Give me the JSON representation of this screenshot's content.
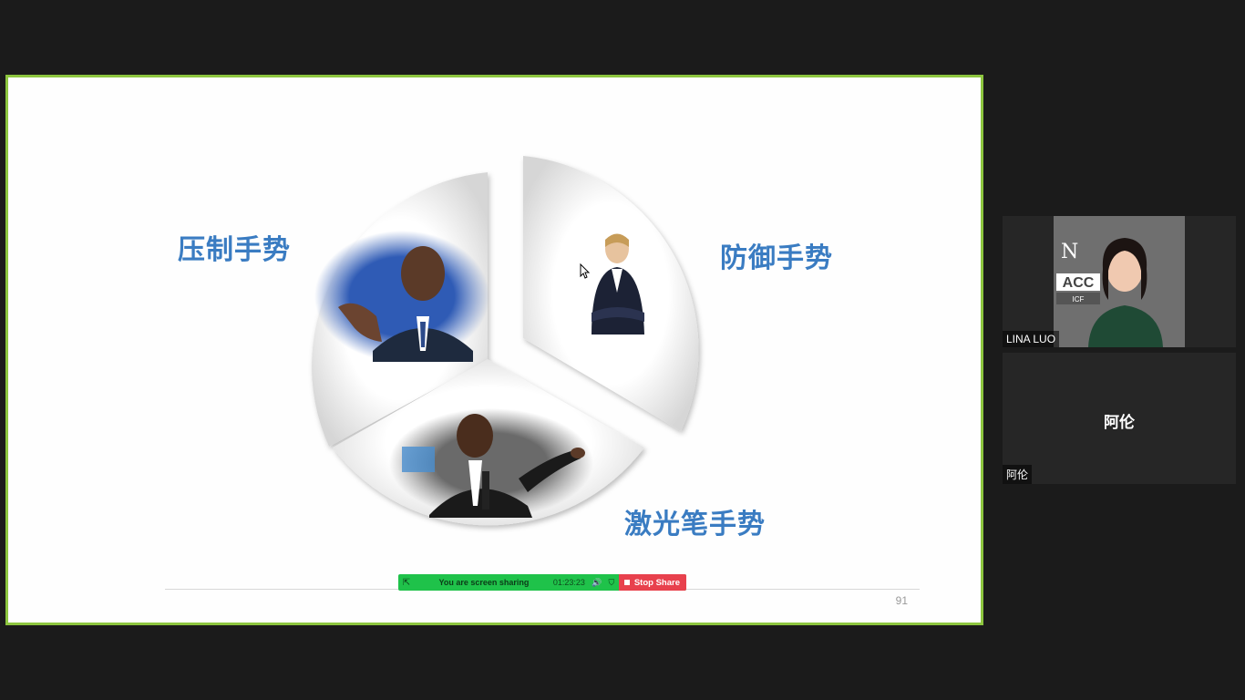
{
  "slide": {
    "labels": {
      "suppress": "压制手势",
      "defend": "防御手势",
      "laser": "激光笔手势"
    },
    "page_number": "91"
  },
  "share_bar": {
    "message": "You are screen sharing",
    "timer": "01:23:23",
    "stop_label": "Stop Share"
  },
  "participants": [
    {
      "name": "LINA LUO",
      "badge_text": "ACC",
      "badge_sub": "ICF"
    },
    {
      "name": "阿伦",
      "center_name": "阿伦"
    }
  ],
  "colors": {
    "frame_border": "#8dc63f",
    "label_blue": "#3a7cc2",
    "share_green": "#1fc24a",
    "stop_red": "#e8414d"
  }
}
